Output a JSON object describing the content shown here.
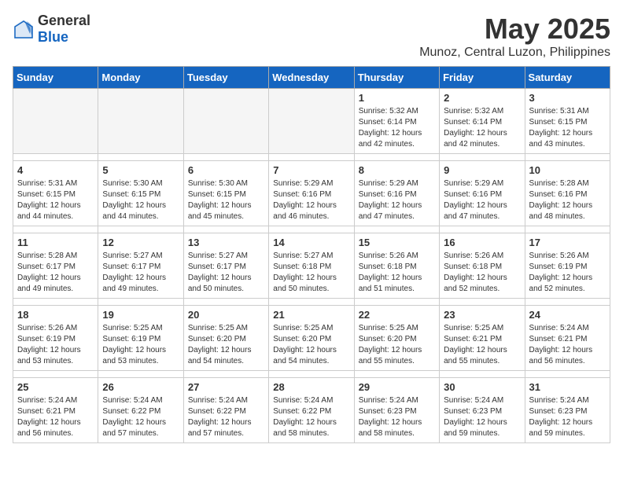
{
  "header": {
    "logo_general": "General",
    "logo_blue": "Blue",
    "title": "May 2025",
    "subtitle": "Munoz, Central Luzon, Philippines"
  },
  "calendar": {
    "weekdays": [
      "Sunday",
      "Monday",
      "Tuesday",
      "Wednesday",
      "Thursday",
      "Friday",
      "Saturday"
    ],
    "weeks": [
      [
        {
          "day": "",
          "info": ""
        },
        {
          "day": "",
          "info": ""
        },
        {
          "day": "",
          "info": ""
        },
        {
          "day": "",
          "info": ""
        },
        {
          "day": "1",
          "info": "Sunrise: 5:32 AM\nSunset: 6:14 PM\nDaylight: 12 hours\nand 42 minutes."
        },
        {
          "day": "2",
          "info": "Sunrise: 5:32 AM\nSunset: 6:14 PM\nDaylight: 12 hours\nand 42 minutes."
        },
        {
          "day": "3",
          "info": "Sunrise: 5:31 AM\nSunset: 6:15 PM\nDaylight: 12 hours\nand 43 minutes."
        }
      ],
      [
        {
          "day": "4",
          "info": "Sunrise: 5:31 AM\nSunset: 6:15 PM\nDaylight: 12 hours\nand 44 minutes."
        },
        {
          "day": "5",
          "info": "Sunrise: 5:30 AM\nSunset: 6:15 PM\nDaylight: 12 hours\nand 44 minutes."
        },
        {
          "day": "6",
          "info": "Sunrise: 5:30 AM\nSunset: 6:15 PM\nDaylight: 12 hours\nand 45 minutes."
        },
        {
          "day": "7",
          "info": "Sunrise: 5:29 AM\nSunset: 6:16 PM\nDaylight: 12 hours\nand 46 minutes."
        },
        {
          "day": "8",
          "info": "Sunrise: 5:29 AM\nSunset: 6:16 PM\nDaylight: 12 hours\nand 47 minutes."
        },
        {
          "day": "9",
          "info": "Sunrise: 5:29 AM\nSunset: 6:16 PM\nDaylight: 12 hours\nand 47 minutes."
        },
        {
          "day": "10",
          "info": "Sunrise: 5:28 AM\nSunset: 6:16 PM\nDaylight: 12 hours\nand 48 minutes."
        }
      ],
      [
        {
          "day": "11",
          "info": "Sunrise: 5:28 AM\nSunset: 6:17 PM\nDaylight: 12 hours\nand 49 minutes."
        },
        {
          "day": "12",
          "info": "Sunrise: 5:27 AM\nSunset: 6:17 PM\nDaylight: 12 hours\nand 49 minutes."
        },
        {
          "day": "13",
          "info": "Sunrise: 5:27 AM\nSunset: 6:17 PM\nDaylight: 12 hours\nand 50 minutes."
        },
        {
          "day": "14",
          "info": "Sunrise: 5:27 AM\nSunset: 6:18 PM\nDaylight: 12 hours\nand 50 minutes."
        },
        {
          "day": "15",
          "info": "Sunrise: 5:26 AM\nSunset: 6:18 PM\nDaylight: 12 hours\nand 51 minutes."
        },
        {
          "day": "16",
          "info": "Sunrise: 5:26 AM\nSunset: 6:18 PM\nDaylight: 12 hours\nand 52 minutes."
        },
        {
          "day": "17",
          "info": "Sunrise: 5:26 AM\nSunset: 6:19 PM\nDaylight: 12 hours\nand 52 minutes."
        }
      ],
      [
        {
          "day": "18",
          "info": "Sunrise: 5:26 AM\nSunset: 6:19 PM\nDaylight: 12 hours\nand 53 minutes."
        },
        {
          "day": "19",
          "info": "Sunrise: 5:25 AM\nSunset: 6:19 PM\nDaylight: 12 hours\nand 53 minutes."
        },
        {
          "day": "20",
          "info": "Sunrise: 5:25 AM\nSunset: 6:20 PM\nDaylight: 12 hours\nand 54 minutes."
        },
        {
          "day": "21",
          "info": "Sunrise: 5:25 AM\nSunset: 6:20 PM\nDaylight: 12 hours\nand 54 minutes."
        },
        {
          "day": "22",
          "info": "Sunrise: 5:25 AM\nSunset: 6:20 PM\nDaylight: 12 hours\nand 55 minutes."
        },
        {
          "day": "23",
          "info": "Sunrise: 5:25 AM\nSunset: 6:21 PM\nDaylight: 12 hours\nand 55 minutes."
        },
        {
          "day": "24",
          "info": "Sunrise: 5:24 AM\nSunset: 6:21 PM\nDaylight: 12 hours\nand 56 minutes."
        }
      ],
      [
        {
          "day": "25",
          "info": "Sunrise: 5:24 AM\nSunset: 6:21 PM\nDaylight: 12 hours\nand 56 minutes."
        },
        {
          "day": "26",
          "info": "Sunrise: 5:24 AM\nSunset: 6:22 PM\nDaylight: 12 hours\nand 57 minutes."
        },
        {
          "day": "27",
          "info": "Sunrise: 5:24 AM\nSunset: 6:22 PM\nDaylight: 12 hours\nand 57 minutes."
        },
        {
          "day": "28",
          "info": "Sunrise: 5:24 AM\nSunset: 6:22 PM\nDaylight: 12 hours\nand 58 minutes."
        },
        {
          "day": "29",
          "info": "Sunrise: 5:24 AM\nSunset: 6:23 PM\nDaylight: 12 hours\nand 58 minutes."
        },
        {
          "day": "30",
          "info": "Sunrise: 5:24 AM\nSunset: 6:23 PM\nDaylight: 12 hours\nand 59 minutes."
        },
        {
          "day": "31",
          "info": "Sunrise: 5:24 AM\nSunset: 6:23 PM\nDaylight: 12 hours\nand 59 minutes."
        }
      ]
    ]
  }
}
